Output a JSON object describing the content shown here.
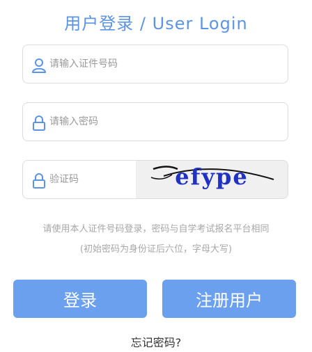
{
  "title": "用户登录 / User Login",
  "fields": {
    "id_number_placeholder": "请输入证件号码",
    "password_placeholder": "请输入密码",
    "captcha_placeholder": "验证码"
  },
  "captcha": {
    "code": "efype"
  },
  "hints": {
    "line1": "请使用本人证件号码登录，密码与自学考试报名平台相同",
    "line2": "(初始密码为身份证后六位，字母大写)"
  },
  "buttons": {
    "login": "登录",
    "register": "注册用户"
  },
  "forgot": "忘记密码?",
  "icons": {
    "user": "user-icon",
    "lock": "lock-icon"
  },
  "colors": {
    "accent": "#6aa0ee",
    "title": "#5b94e6",
    "icon": "#5b94e6"
  }
}
